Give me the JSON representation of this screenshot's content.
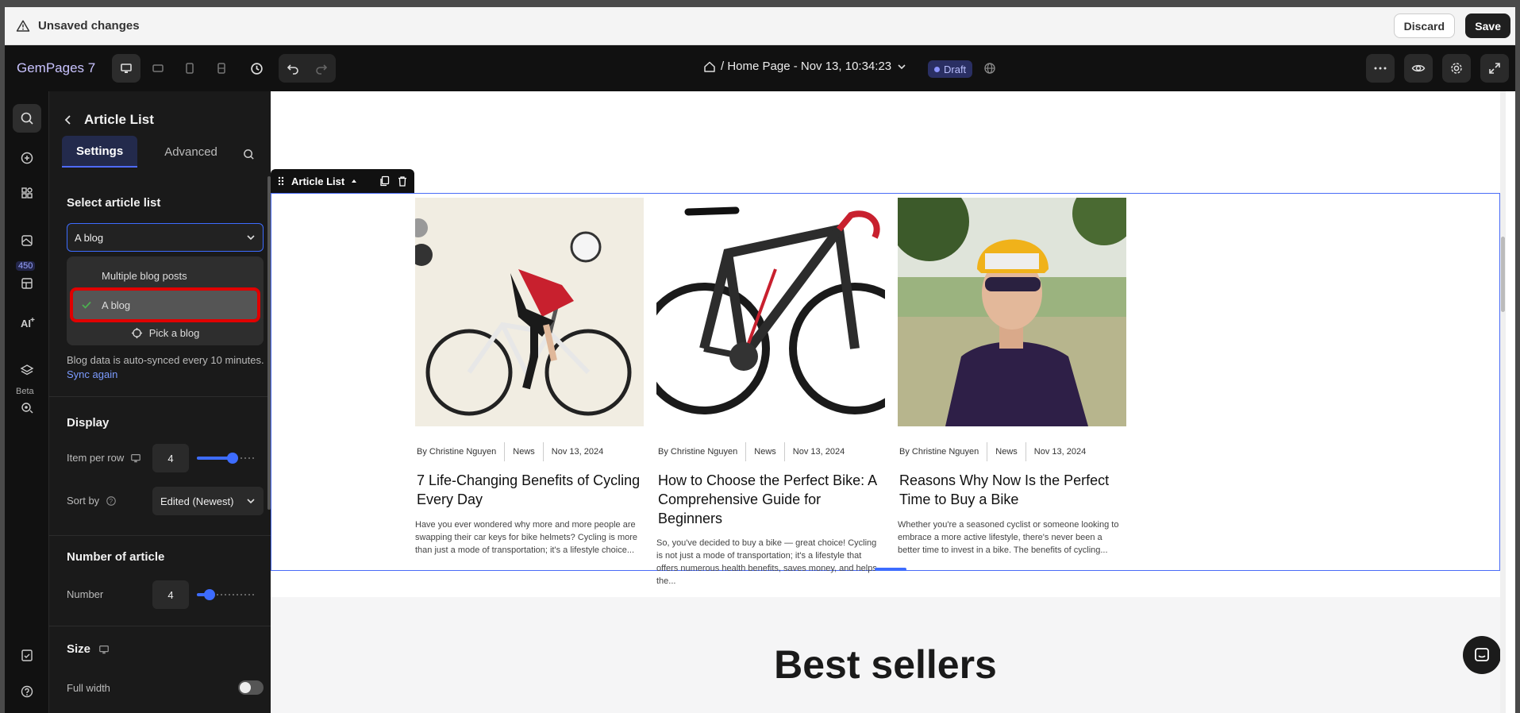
{
  "unsaved": {
    "text": "Unsaved changes",
    "discard": "Discard",
    "save": "Save"
  },
  "topbar": {
    "brand": "GemPages 7",
    "page_title": "/ Home Page - Nov 13, 10:34:23",
    "status": "Draft"
  },
  "rail": {
    "badge": "450",
    "beta": "Beta"
  },
  "panel": {
    "title": "Article List",
    "tabs": [
      "Settings",
      "Advanced"
    ],
    "select_label": "Select article list",
    "select_value": "A blog",
    "options": [
      "Multiple blog posts",
      "A blog"
    ],
    "pick_blog": "Pick a blog",
    "sync_note": "Blog data is auto-synced every 10 minutes.",
    "sync_link": "Sync again",
    "display_title": "Display",
    "item_per_row_label": "Item per row",
    "item_per_row_value": "4",
    "item_per_row_level": 0.65,
    "sort_label": "Sort by",
    "sort_value": "Edited (Newest)",
    "number_title": "Number of article",
    "number_label": "Number",
    "number_value": "4",
    "number_level": 0.15,
    "size_title": "Size",
    "full_width_label": "Full width"
  },
  "canvas": {
    "toolbar_label": "Article List",
    "cards": [
      {
        "author": "By Christine Nguyen",
        "category": "News",
        "date": "Nov 13, 2024",
        "title": "7 Life-Changing Benefits of Cycling Every Day",
        "excerpt": "Have you ever wondered why more and more people are swapping their car keys for bike helmets? Cycling is more than just a mode of transportation; it's a lifestyle choice..."
      },
      {
        "author": "By Christine Nguyen",
        "category": "News",
        "date": "Nov 13, 2024",
        "title": "How to Choose the Perfect Bike: A Comprehensive Guide for Beginners",
        "excerpt": "So, you've decided to buy a bike — great choice! Cycling is not just a mode of transportation; it's a lifestyle that offers numerous health benefits, saves money, and helps the..."
      },
      {
        "author": "By Christine Nguyen",
        "category": "News",
        "date": "Nov 13, 2024",
        "title": "Reasons Why Now Is the Perfect Time to Buy a Bike",
        "excerpt": "Whether you're a seasoned cyclist or someone looking to embrace a more active lifestyle, there's never been a better time to invest in a bike. The benefits of cycling..."
      }
    ],
    "best_sellers": "Best sellers"
  }
}
